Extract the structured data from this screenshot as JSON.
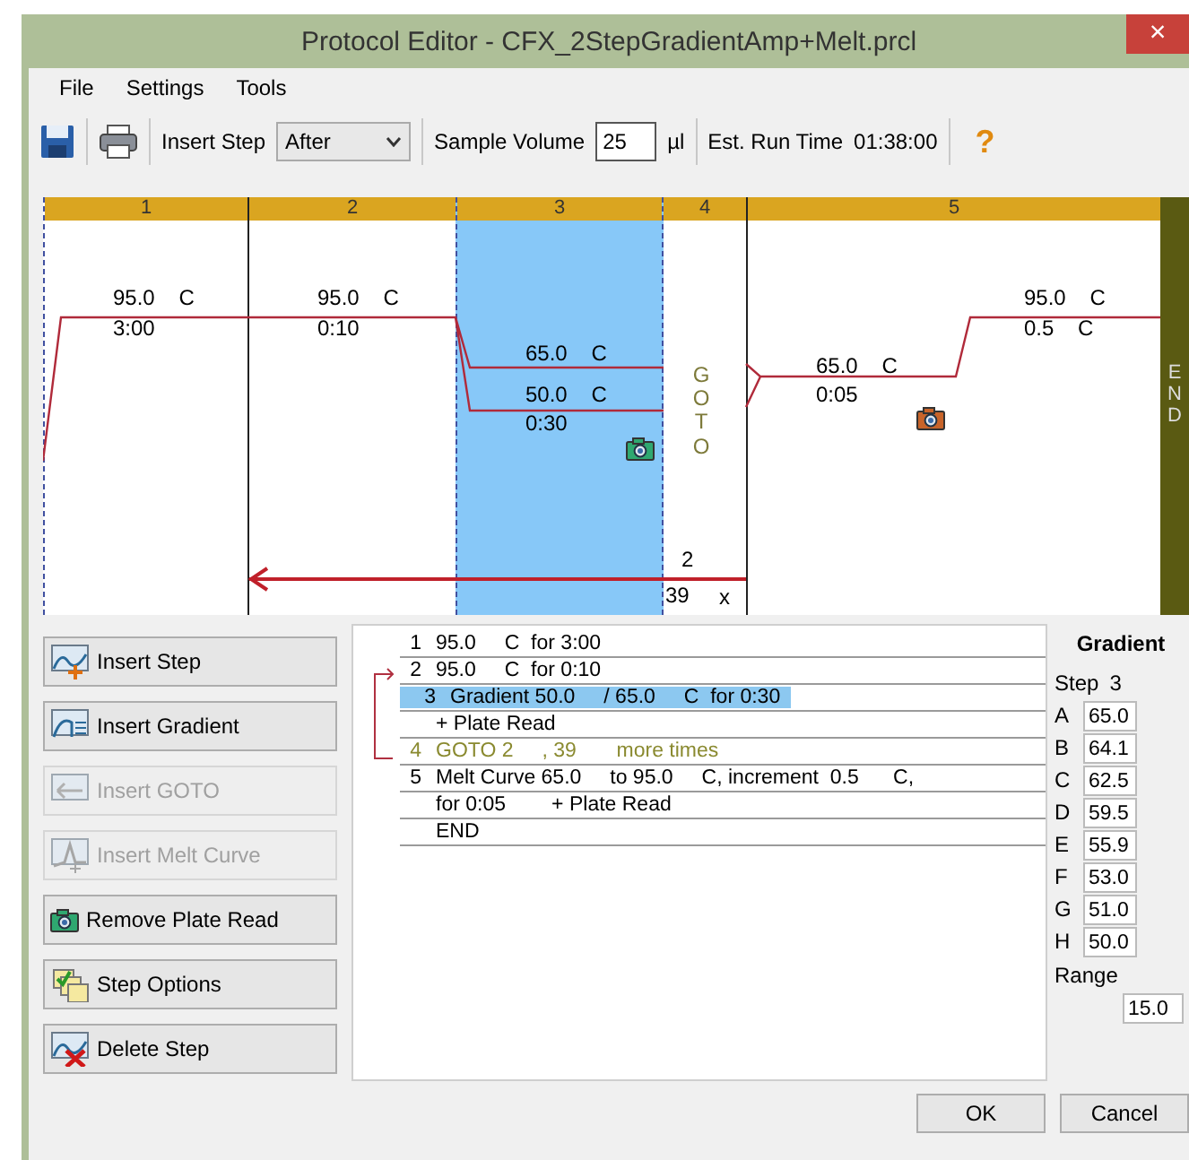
{
  "window": {
    "title": "Protocol Editor - CFX_2StepGradientAmp+Melt.prcl",
    "close": "×"
  },
  "menu": [
    "File",
    "Settings",
    "Tools"
  ],
  "toolbar": {
    "insert_step_label": "Insert Step",
    "insert_step_value": "After",
    "sample_volume_label": "Sample Volume",
    "sample_volume": "25",
    "volume_unit": "µl",
    "run_time_label": "Est. Run Time",
    "run_time": "01:38:00",
    "help": "?"
  },
  "graph": {
    "columns": [
      {
        "label": "1",
        "kind": "hold",
        "selected": false,
        "temp": "95.0",
        "unit": "C",
        "time": "3:00"
      },
      {
        "label": "2",
        "kind": "hold",
        "selected": false,
        "temp": "95.0",
        "unit": "C",
        "time": "0:10"
      },
      {
        "label": "3",
        "kind": "gradient",
        "selected": true,
        "high_temp": "65.0",
        "high_unit": "C",
        "low_temp": "50.0",
        "low_unit": "C",
        "time": "0:30",
        "plate_read": true
      },
      {
        "label": "4",
        "kind": "goto",
        "selected": false,
        "text": "GOTO",
        "target": "2",
        "count": "39",
        "times": "x"
      },
      {
        "label": "5",
        "kind": "melt",
        "selected": false,
        "start_temp": "65.0",
        "start_unit": "C",
        "time": "0:05",
        "end_temp": "95.0",
        "end_unit": "C",
        "increment": "0.5",
        "increment_unit": "C",
        "plate_read": true
      }
    ],
    "end_label": "END"
  },
  "buttons": [
    {
      "label": "Insert Step",
      "kind": "insert_step",
      "disabled": false
    },
    {
      "label": "Insert Gradient",
      "kind": "gradient",
      "disabled": false
    },
    {
      "label": "Insert GOTO",
      "kind": "goto",
      "disabled": true
    },
    {
      "label": "Insert Melt Curve",
      "kind": "melt",
      "disabled": true
    },
    {
      "label": "Remove Plate Read",
      "kind": "plate_read",
      "disabled": false
    },
    {
      "label": "Step Options",
      "kind": "options",
      "disabled": false
    },
    {
      "label": "Delete Step",
      "kind": "delete",
      "disabled": false
    }
  ],
  "step_list": [
    {
      "number": "1",
      "text": "95.0     C  for 3:00",
      "kind": "step",
      "selected": false
    },
    {
      "number": "2",
      "text": "95.0     C  for 0:10",
      "kind": "step",
      "selected": false
    },
    {
      "number": "3",
      "text": "Gradient 50.0     / 65.0     C  for 0:30",
      "kind": "step",
      "selected": true
    },
    {
      "text": "+ Plate Read",
      "kind": "detail",
      "selected": false
    },
    {
      "number": "4",
      "text": "GOTO 2     , 39       more times",
      "kind": "goto",
      "selected": false
    },
    {
      "number": "5",
      "text": "Melt Curve 65.0     to 95.0     C, increment  0.5      C,",
      "kind": "step",
      "selected": false
    },
    {
      "text": "for 0:05        + Plate Read",
      "kind": "detail",
      "selected": false
    },
    {
      "text": "END",
      "kind": "detail",
      "selected": false
    }
  ],
  "gradient": {
    "title": "Gradient",
    "step_label": "Step",
    "step": "3",
    "rows": [
      {
        "row": "A",
        "temp": "65.0"
      },
      {
        "row": "B",
        "temp": "64.1"
      },
      {
        "row": "C",
        "temp": "62.5"
      },
      {
        "row": "D",
        "temp": "59.5"
      },
      {
        "row": "E",
        "temp": "55.9"
      },
      {
        "row": "F",
        "temp": "53.0"
      },
      {
        "row": "G",
        "temp": "51.0"
      },
      {
        "row": "H",
        "temp": "50.0"
      }
    ],
    "range_label": "Range",
    "range": "15.0"
  },
  "footer": [
    "OK",
    "Cancel"
  ]
}
